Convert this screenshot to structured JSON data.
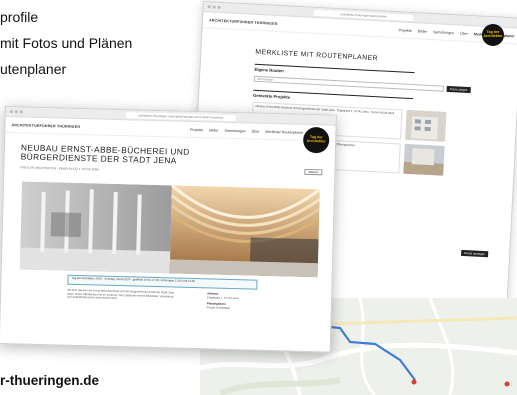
{
  "intro": {
    "line1": "profile",
    "line2": "mit Fotos und Plänen",
    "line3": "utenplaner"
  },
  "domain_text": "r-thueringen.de",
  "back_window": {
    "url": "architektur-thueringen.de/merkliste",
    "brand": "ARCHITEKTURFÜHRER THÜRINGEN",
    "nav": [
      "Projekte",
      "Bilder",
      "Sammlungen",
      "Über",
      "Merkliste/ Routenplaner"
    ],
    "title": "MERKLISTE MIT ROUTENPLANER",
    "route_section": "Eigene Routen",
    "search_placeholder": "Ort/Adresse",
    "search_button": "Route zeigen",
    "saved_section": "Gemerkte Projekte",
    "projects": [
      {
        "text": "Neubau Ernst-Abbe-Bücherei und Bürgerdienste der Stadt Jena · Engelplatz 1, 07743 Jena · Termin 08.06.2024",
        "thumb_label": ""
      },
      {
        "text": "Umbau Campus Inselplatz, Universität Jena · Termin 08.06.2024 · Öffnungszeiten",
        "thumb_label": ""
      }
    ],
    "route_button": "Route anzeigen"
  },
  "logo": {
    "text": "Tag der Architektur"
  },
  "front_window": {
    "url": "architektur-thueringen.de/projekte/neubau-ernst-abbe-buecherei",
    "brand": "ARCHITEKTURFÜHRER THÜRINGEN",
    "nav": [
      "Projekte",
      "Bilder",
      "Sammlungen",
      "Über",
      "Merkliste/ Routenplaner"
    ],
    "title_line1": "NEUBAU ERNST-ABBE-BÜCHEREI UND",
    "title_line2": "BÜRGERDIENSTE DER STADT JENA",
    "subtitle": "FREYLER ARCHITEKTEN · ENGELPLATZ 1, 07743 JENA",
    "merken_button": "Merken",
    "info": "Tag der Architektur 2024 · Sonntag, 08.06.2024 · geöffnet 10:00–17:00, Führungen 11:00 und 14:00",
    "description": "Mit dem Neubau der Ernst-Abbe-Bücherei und der Bürgerdienste erhält die Stadt Jena einen neuen öffentlichen Ort im Zentrum. Das Gebäude vereint Bibliothek, Verwaltung und Aufenthaltsräume unter einem Dach.",
    "meta_label1": "Adresse",
    "meta_value1": "Engelplatz 1, 07743 Jena",
    "meta_label2": "Planungsbüro",
    "meta_value2": "Freyler Architekten"
  },
  "colors": {
    "accent_blue": "#3f7ed8",
    "info_border": "#6aa8c8",
    "logo_bg": "#111111",
    "logo_text": "#f2c500"
  }
}
